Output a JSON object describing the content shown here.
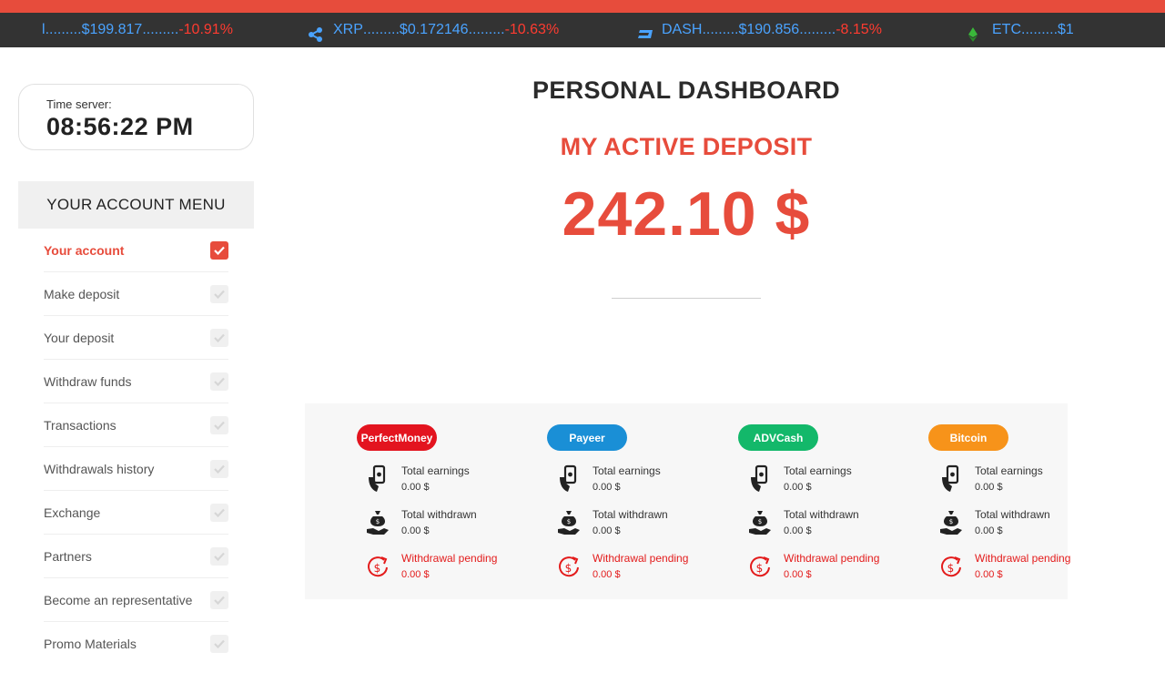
{
  "ticker": [
    {
      "symbol": "l",
      "price": "$199.817",
      "change": "-10.91%",
      "icon": "coin-icon"
    },
    {
      "symbol": "XRP",
      "price": "$0.172146",
      "change": "-10.63%",
      "icon": "xrp-icon"
    },
    {
      "symbol": "DASH",
      "price": "$190.856",
      "change": "-8.15%",
      "icon": "dash-icon"
    },
    {
      "symbol": "ETC",
      "price": "$1",
      "change": "",
      "icon": "etc-icon"
    }
  ],
  "time_server": {
    "label": "Time server:",
    "value": "08:56:22 PM"
  },
  "menu": {
    "title": "YOUR ACCOUNT MENU",
    "items": [
      {
        "label": "Your account",
        "active": true
      },
      {
        "label": "Make deposit"
      },
      {
        "label": "Your deposit"
      },
      {
        "label": "Withdraw funds"
      },
      {
        "label": "Transactions"
      },
      {
        "label": "Withdrawals history"
      },
      {
        "label": "Exchange"
      },
      {
        "label": "Partners"
      },
      {
        "label": "Become an representative"
      },
      {
        "label": "Promo Materials"
      }
    ]
  },
  "dashboard": {
    "title": "PERSONAL DASHBOARD",
    "subtitle": "MY ACTIVE DEPOSIT",
    "amount": "242.10 $"
  },
  "colors": {
    "accent": "#e74c3c",
    "perfectmoney": "#e3141f",
    "payeer": "#1a8fd6",
    "advcash": "#13b86a",
    "bitcoin": "#f7931a"
  },
  "payment_systems": [
    {
      "name": "PerfectMoney",
      "earnings_label": "Total earnings",
      "earnings": "0.00 $",
      "withdrawn_label": "Total withdrawn",
      "withdrawn": "0.00 $",
      "pending_label": "Withdrawal pending",
      "pending": "0.00 $"
    },
    {
      "name": "Payeer",
      "earnings_label": "Total earnings",
      "earnings": "0.00 $",
      "withdrawn_label": "Total withdrawn",
      "withdrawn": "0.00 $",
      "pending_label": "Withdrawal pending",
      "pending": "0.00 $"
    },
    {
      "name": "ADVCash",
      "earnings_label": "Total earnings",
      "earnings": "0.00 $",
      "withdrawn_label": "Total withdrawn",
      "withdrawn": "0.00 $",
      "pending_label": "Withdrawal pending",
      "pending": "0.00 $"
    },
    {
      "name": "Bitcoin",
      "earnings_label": "Total earnings",
      "earnings": "0.00 $",
      "withdrawn_label": "Total withdrawn",
      "withdrawn": "0.00 $",
      "pending_label": "Withdrawal pending",
      "pending": "0.00 $"
    }
  ]
}
